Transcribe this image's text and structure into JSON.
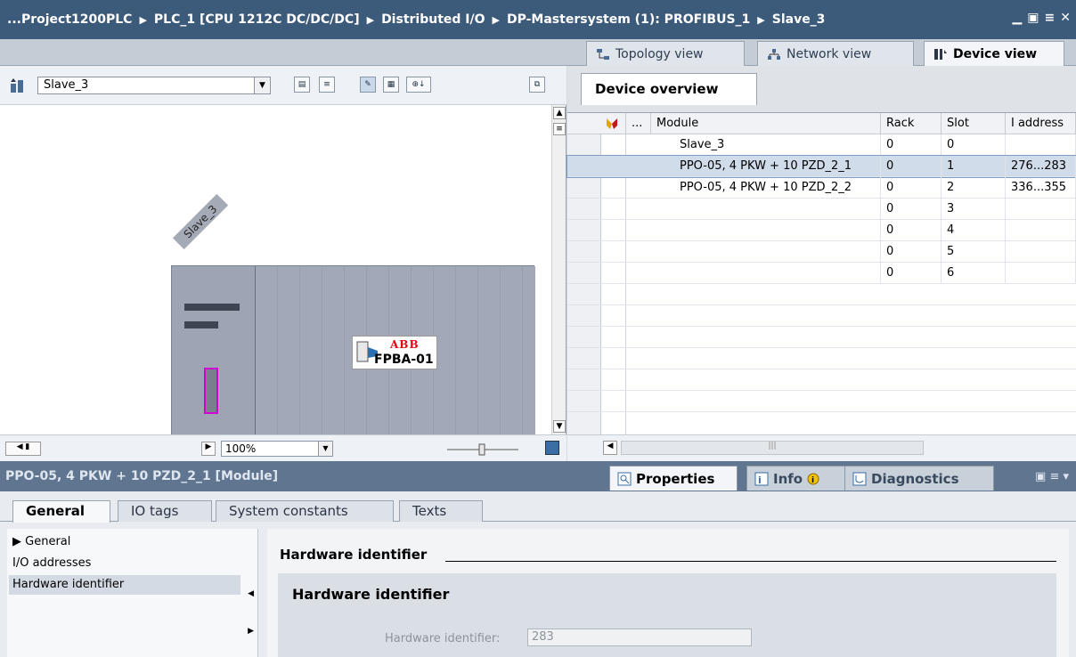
{
  "titlebar": {
    "crumbs": [
      "...Project1200PLC",
      "PLC_1 [CPU 1212C DC/DC/DC]",
      "Distributed I/O",
      "DP-Mastersystem (1): PROFIBUS_1",
      "Slave_3"
    ],
    "separator": "▶",
    "win_buttons": [
      "▁",
      "▣",
      "≡",
      "✕"
    ]
  },
  "view_tabs": [
    {
      "label": "Topology view",
      "icon": "topology-icon"
    },
    {
      "label": "Network view",
      "icon": "network-icon"
    },
    {
      "label": "Device view",
      "icon": "device-icon",
      "active": true
    }
  ],
  "left_pane": {
    "device_select": "Slave_3",
    "rack_label": "Slave_3",
    "module": {
      "brand": "ABB",
      "name": "FPBA-01"
    },
    "zoom": "100%"
  },
  "device_overview": {
    "tab": "Device overview",
    "columns": [
      "...",
      "Module",
      "Rack",
      "Slot",
      "I address"
    ],
    "rows": [
      {
        "module": "Slave_3",
        "rack": "0",
        "slot": "0",
        "iaddr": ""
      },
      {
        "module": "PPO-05, 4 PKW + 10 PZD_2_1",
        "rack": "0",
        "slot": "1",
        "iaddr": "276...283",
        "selected": true
      },
      {
        "module": "PPO-05, 4 PKW + 10 PZD_2_2",
        "rack": "0",
        "slot": "2",
        "iaddr": "336...355"
      },
      {
        "module": "",
        "rack": "0",
        "slot": "3",
        "iaddr": ""
      },
      {
        "module": "",
        "rack": "0",
        "slot": "4",
        "iaddr": ""
      },
      {
        "module": "",
        "rack": "0",
        "slot": "5",
        "iaddr": ""
      },
      {
        "module": "",
        "rack": "0",
        "slot": "6",
        "iaddr": ""
      }
    ]
  },
  "properties": {
    "title": "PPO-05, 4 PKW + 10 PZD_2_1 [Module]",
    "tabs": [
      "Properties",
      "Info",
      "Diagnostics"
    ],
    "subtabs": [
      "General",
      "IO tags",
      "System constants",
      "Texts"
    ],
    "nav": [
      "General",
      "I/O addresses",
      "Hardware identifier"
    ],
    "section_title": "Hardware identifier",
    "group_title": "Hardware identifier",
    "field_label": "Hardware identifier:",
    "field_value": "283"
  },
  "colors": {
    "titlebar": "#3c5a7a",
    "rack": "#a3a8b9",
    "port_highlight": "#d400d4",
    "abb_red": "#e30613",
    "selected_row": "#d0dcea"
  }
}
